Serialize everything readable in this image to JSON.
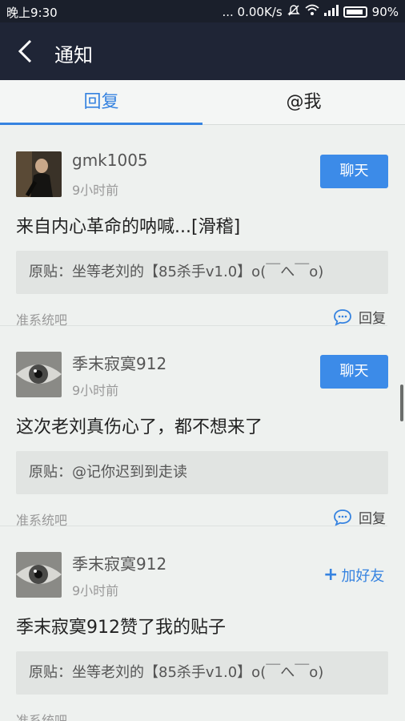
{
  "status_bar": {
    "time": "晚上9:30",
    "network": "... 0.00K/s",
    "battery": "90%"
  },
  "header": {
    "title": "通知"
  },
  "tabs": [
    {
      "label": "回复",
      "active": true
    },
    {
      "label": "@我",
      "active": false
    }
  ],
  "notifications": [
    {
      "username": "gmk1005",
      "time": "9小时前",
      "action": "聊天",
      "content": "来自内心革命的呐喊...[滑稽]",
      "quote": "原贴：坐等老刘的【85杀手v1.0】o(￣へ￣o)",
      "forum": "准系统吧",
      "reply_label": "回复"
    },
    {
      "username": "季末寂寞912",
      "time": "9小时前",
      "action": "聊天",
      "content": "这次老刘真伤心了，都不想来了",
      "quote": "原贴：@记你迟到到走读",
      "forum": "准系统吧",
      "reply_label": "回复"
    },
    {
      "username": "季末寂寞912",
      "time": "9小时前",
      "action": "加好友",
      "content": "季末寂寞912赞了我的贴子",
      "quote": "原贴：坐等老刘的【85杀手v1.0】o(￣へ￣o)",
      "forum": "准系统吧"
    }
  ],
  "colors": {
    "accent": "#3683e0",
    "header_bg": "#1f2536",
    "chat_button": "#3c8be8"
  }
}
